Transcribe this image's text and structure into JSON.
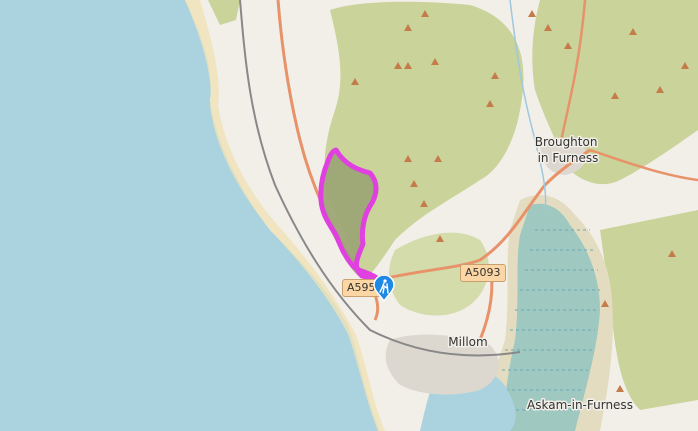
{
  "map": {
    "places": [
      {
        "id": "broughton",
        "lines": [
          "Broughton",
          "in Furness"
        ]
      },
      {
        "id": "millom",
        "lines": [
          "Millom"
        ]
      },
      {
        "id": "askam",
        "lines": [
          "Askam-in-Furness"
        ]
      }
    ],
    "road_shields": [
      {
        "id": "a5093",
        "label": "A5093"
      },
      {
        "id": "a595",
        "label": "A595"
      }
    ],
    "route": {
      "color": "#e040e0"
    },
    "marker": {
      "icon": "hiking-icon",
      "color": "#1e88e5"
    },
    "colors": {
      "sea": "#aad3df",
      "land": "#f2efe9",
      "moor": "#c9d39a",
      "fell": "#b9c587",
      "wetland": "#9ec8c0",
      "sand": "#f0e2b6",
      "road": "#e8926a"
    }
  }
}
